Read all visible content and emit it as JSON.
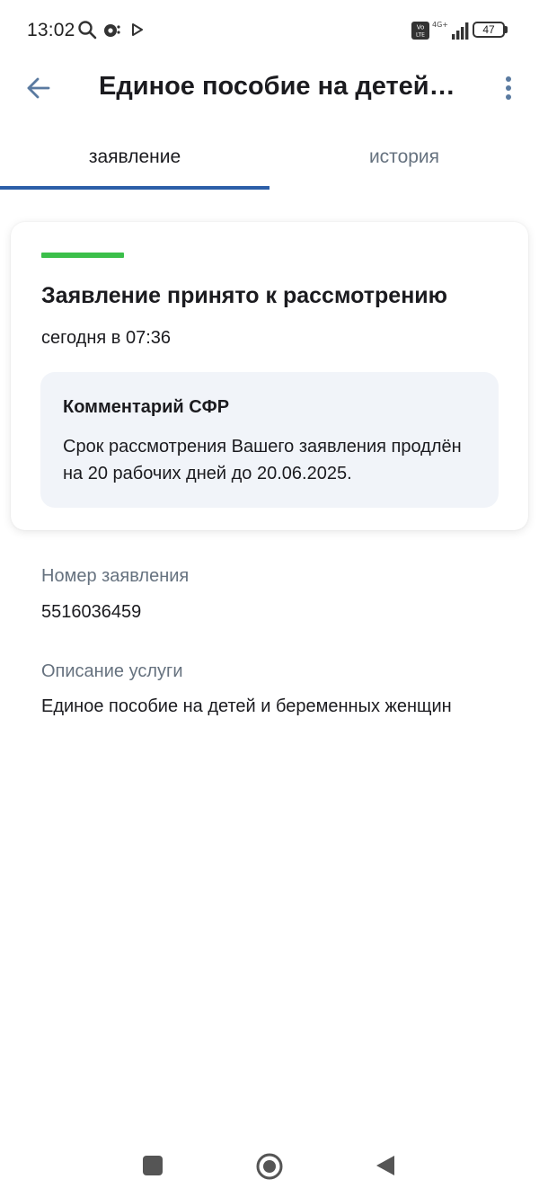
{
  "status_bar": {
    "time": "13:02",
    "battery": "47",
    "network": "4G+"
  },
  "header": {
    "title": "Единое пособие на детей и беременных женщин",
    "back_icon": "arrow-left-icon",
    "more_icon": "more-vertical-icon"
  },
  "tabs": [
    {
      "label": "заявление",
      "active": true
    },
    {
      "label": "история",
      "active": false
    }
  ],
  "status_card": {
    "status_color": "#3bbf4a",
    "title": "Заявление принято к рассмотрению",
    "date": "сегодня в 07:36",
    "comment": {
      "title": "Комментарий СФР",
      "text": "Срок рассмотрения Вашего заявления продлён на 20 рабочих дней до 20.06.2025."
    }
  },
  "fields": {
    "number_label": "Номер заявления",
    "number_value": "5516036459",
    "service_label": "Описание услуги",
    "service_value": "Единое пособие на детей и беременных женщин"
  },
  "colors": {
    "accent": "#2c5fa8",
    "muted_text": "#66727f",
    "comment_bg": "#f1f4f9"
  }
}
